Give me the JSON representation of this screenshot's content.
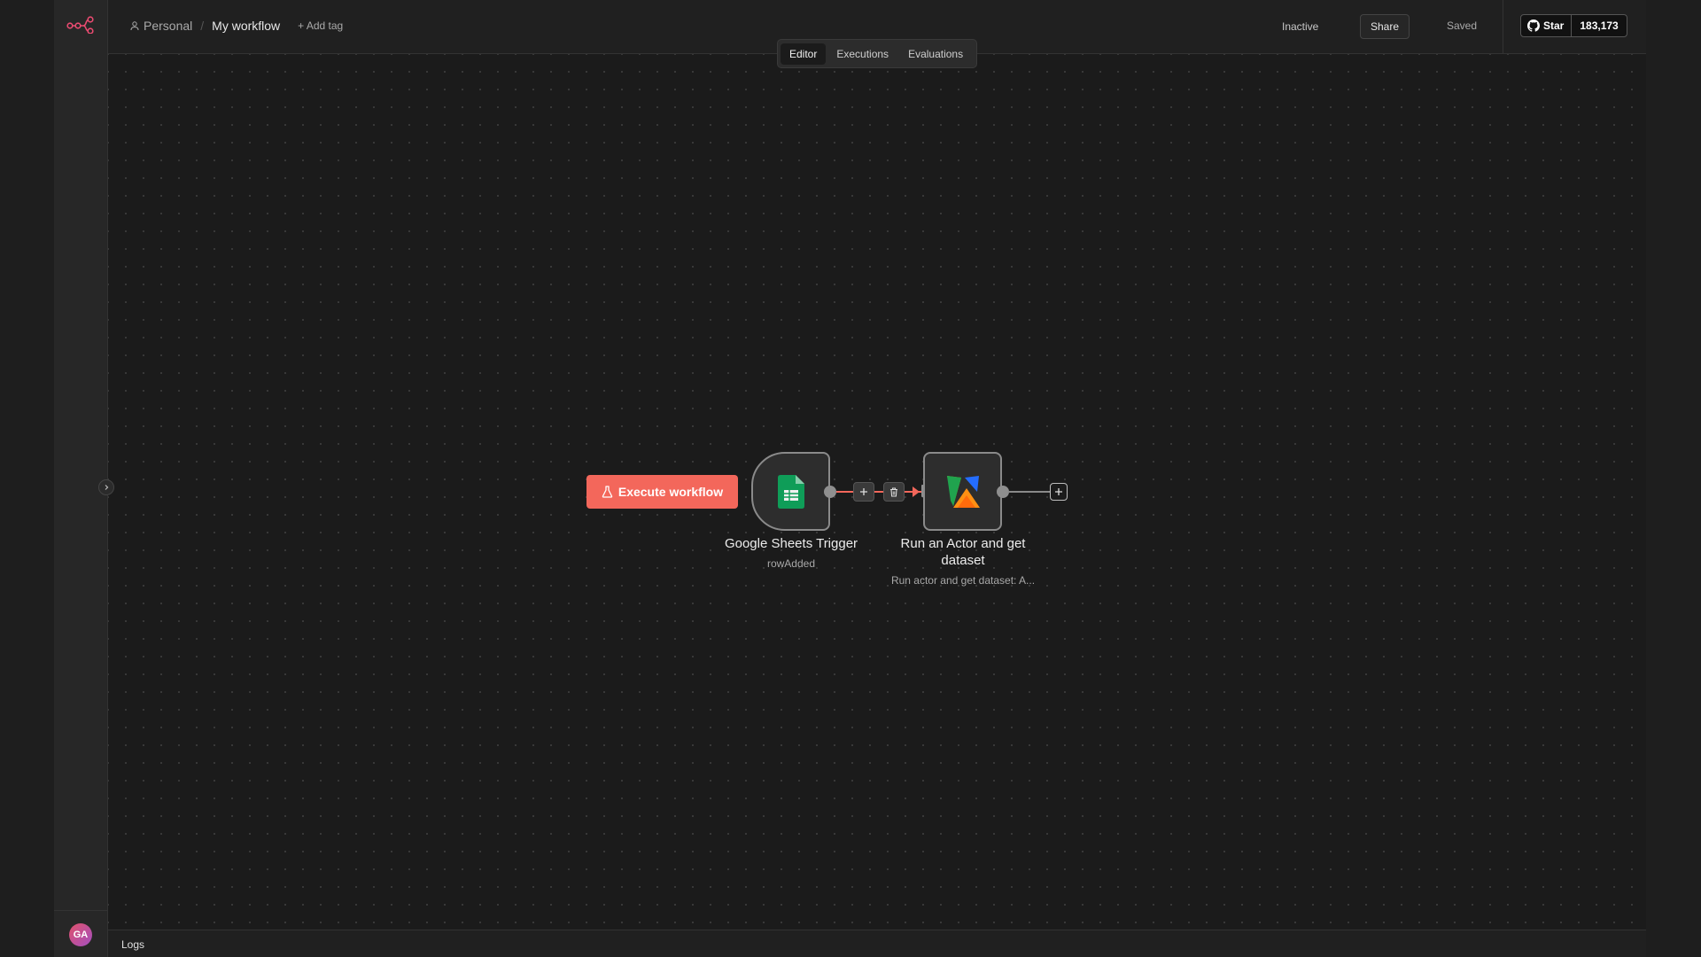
{
  "app": {
    "brand_color": "#ea4b71",
    "accent_color": "#f3675b"
  },
  "sidebar": {
    "user_initials": "GA"
  },
  "header": {
    "breadcrumb_project": "Personal",
    "breadcrumb_separator": "/",
    "workflow_name": "My workflow",
    "add_tag_label": "+ Add tag",
    "status": "Inactive",
    "share_label": "Share",
    "saved_label": "Saved",
    "github_star_label": "Star",
    "github_star_count": "183,173"
  },
  "tabs": [
    {
      "label": "Editor",
      "active": true
    },
    {
      "label": "Executions",
      "active": false
    },
    {
      "label": "Evaluations",
      "active": false
    }
  ],
  "canvas": {
    "execute_button_label": "Execute workflow",
    "nodes": [
      {
        "title": "Google Sheets Trigger",
        "subtitle": "rowAdded",
        "icon": "google-sheets-icon"
      },
      {
        "title": "Run an Actor and get dataset",
        "subtitle": "Run actor and get dataset: A...",
        "icon": "apify-icon"
      }
    ]
  },
  "logs": {
    "label": "Logs"
  }
}
